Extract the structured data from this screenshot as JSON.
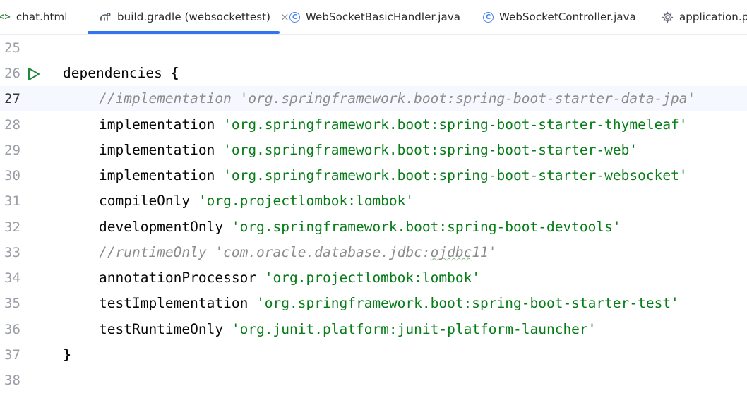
{
  "tabs": [
    {
      "label": "chat.html",
      "icon": "html-file-icon",
      "active": false
    },
    {
      "label": "build.gradle (websockettest)",
      "icon": "gradle-icon",
      "active": true,
      "close": "×"
    },
    {
      "label": "WebSocketBasicHandler.java",
      "icon": "java-class-icon",
      "active": false
    },
    {
      "label": "WebSocketController.java",
      "icon": "java-class-icon",
      "active": false
    },
    {
      "label": "application.pro",
      "icon": "settings-file-icon",
      "active": false
    }
  ],
  "editor": {
    "lines": [
      {
        "num": "25"
      },
      {
        "num": "26",
        "text": "dependencies",
        "brace": "{"
      },
      {
        "num": "27",
        "comment": "//implementation 'org.springframework.boot:spring-boot-starter-data-jpa'"
      },
      {
        "num": "28",
        "keyword": "implementation ",
        "string": "'org.springframework.boot:spring-boot-starter-thymeleaf'"
      },
      {
        "num": "29",
        "keyword": "implementation ",
        "string": "'org.springframework.boot:spring-boot-starter-web'"
      },
      {
        "num": "30",
        "keyword": "implementation ",
        "string": "'org.springframework.boot:spring-boot-starter-websocket'"
      },
      {
        "num": "31",
        "keyword": "compileOnly ",
        "string": "'org.projectlombok:lombok'"
      },
      {
        "num": "32",
        "keyword": "developmentOnly ",
        "string": "'org.springframework.boot:spring-boot-devtools'"
      },
      {
        "num": "33",
        "comment_a": "//runtimeOnly 'com.oracle.database.jdbc:",
        "comment_b": "ojdbc",
        "comment_c": "11'"
      },
      {
        "num": "34",
        "keyword": "annotationProcessor ",
        "string": "'org.projectlombok:lombok'"
      },
      {
        "num": "35",
        "keyword": "testImplementation ",
        "string": "'org.springframework.boot:spring-boot-starter-test'"
      },
      {
        "num": "36",
        "keyword": "testRuntimeOnly ",
        "string": "'org.junit.platform:junit-platform-launcher'"
      },
      {
        "num": "37",
        "brace": "}"
      },
      {
        "num": "38"
      }
    ]
  }
}
